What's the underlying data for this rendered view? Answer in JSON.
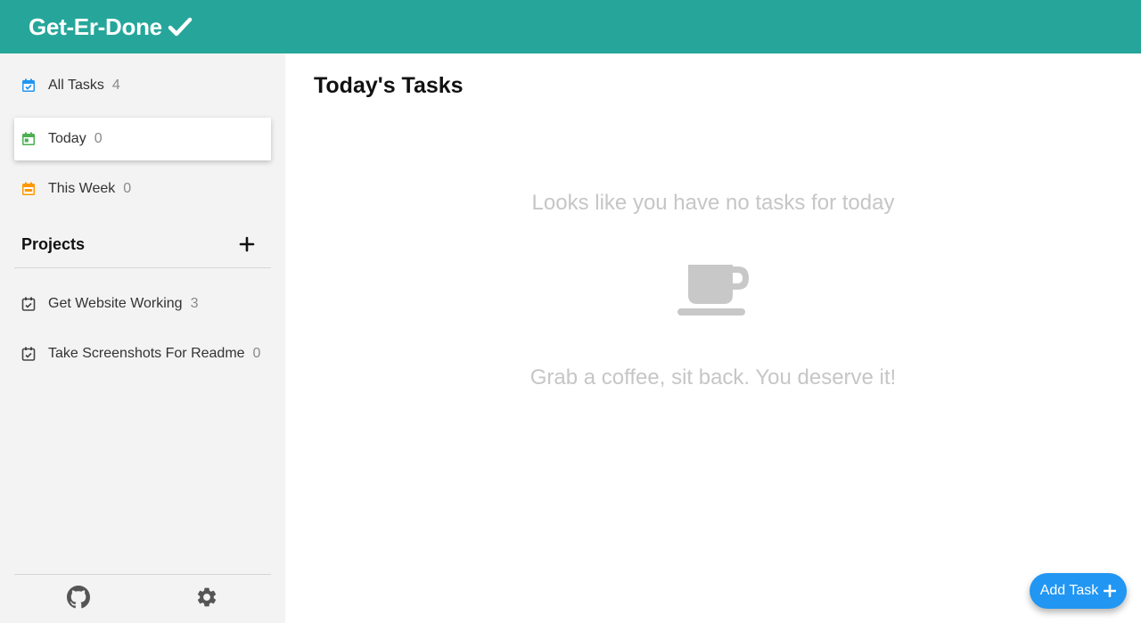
{
  "app": {
    "title": "Get-Er-Done"
  },
  "nav": {
    "items": [
      {
        "label": "All Tasks",
        "count": "4",
        "icon": "calendar-check-icon",
        "color": "#2196f3"
      },
      {
        "label": "Today",
        "count": "0",
        "icon": "calendar-day-icon",
        "color": "#4caf50"
      },
      {
        "label": "This Week",
        "count": "0",
        "icon": "calendar-week-icon",
        "color": "#ff9800"
      }
    ]
  },
  "projects": {
    "title": "Projects",
    "items": [
      {
        "label": "Get Website Working",
        "count": "3",
        "icon": "calendar-check-icon"
      },
      {
        "label": "Take Screenshots For Readme",
        "count": "0",
        "icon": "calendar-check-icon"
      }
    ]
  },
  "footer": {
    "icons": [
      "github-icon",
      "gear-icon"
    ]
  },
  "main": {
    "title": "Today's Tasks",
    "empty_line1": "Looks like you have no tasks for today",
    "empty_line2": "Grab a coffee, sit back. You deserve it!"
  },
  "fab": {
    "label": "Add Task"
  },
  "colors": {
    "header": "#26a69a",
    "accent": "#2196f3",
    "sidebar_bg": "#f3f3f3"
  }
}
